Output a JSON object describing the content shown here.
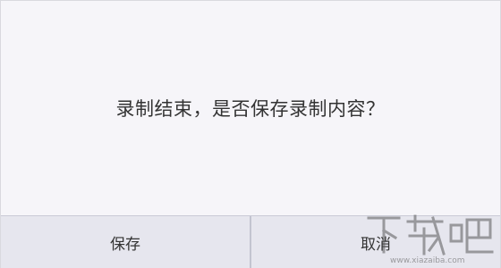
{
  "dialog": {
    "message": "录制结束，是否保存录制内容？",
    "buttons": {
      "save_label": "保存",
      "cancel_label": "取消"
    }
  },
  "watermark": {
    "text": "下载吧",
    "url": "www.xiazaiba.com"
  },
  "colors": {
    "dialog_bg": "#f6f5f9",
    "button_bar_bg": "#e6e6ee",
    "text": "#333333",
    "divider": "#c3c4d0"
  }
}
